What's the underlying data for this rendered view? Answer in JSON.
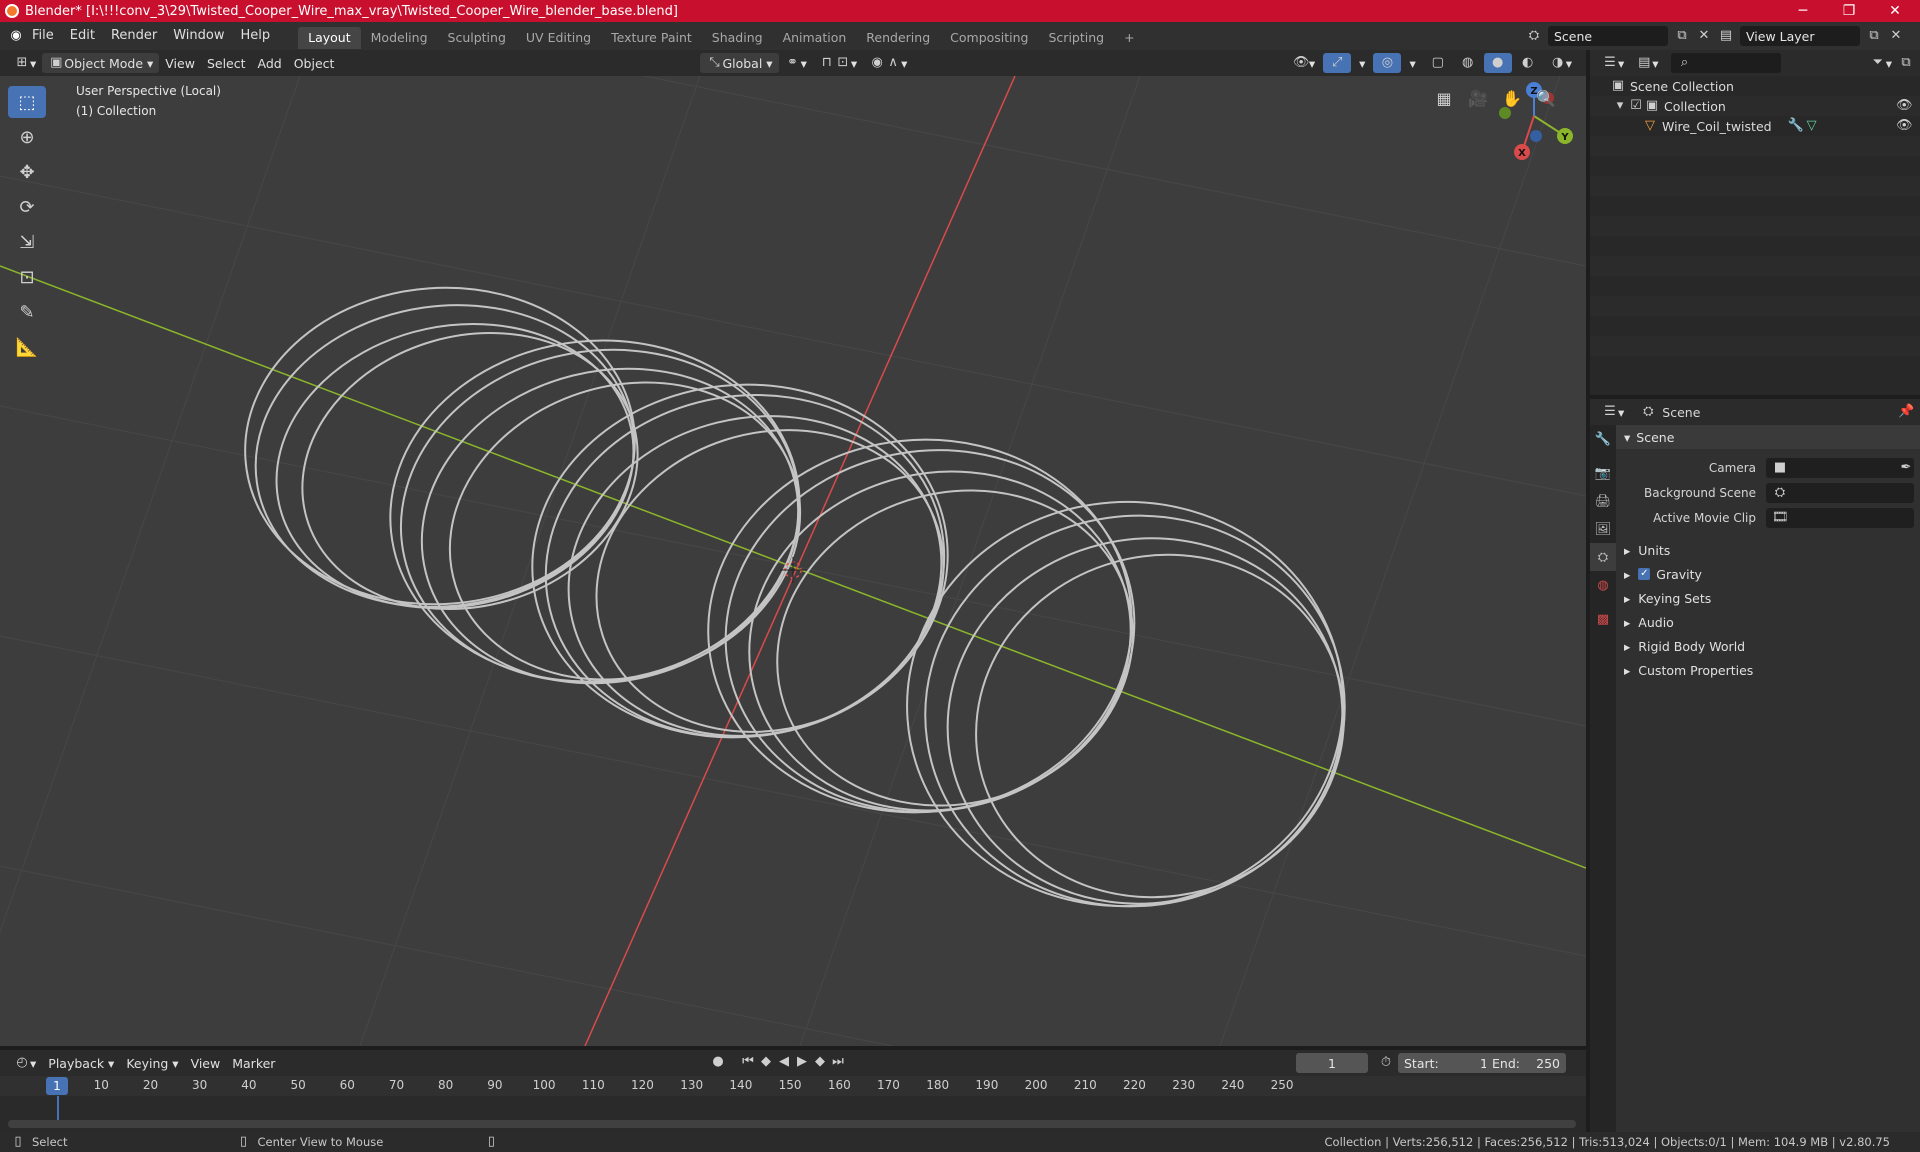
{
  "window": {
    "title": "Blender* [I:\\!!!conv_3\\29\\Twisted_Cooper_Wire_max_vray\\Twisted_Cooper_Wire_blender_base.blend]",
    "minimize": "─",
    "maximize": "❐",
    "close": "✕"
  },
  "menu": [
    "File",
    "Edit",
    "Render",
    "Window",
    "Help"
  ],
  "workspaces": [
    "Layout",
    "Modeling",
    "Sculpting",
    "UV Editing",
    "Texture Paint",
    "Shading",
    "Animation",
    "Rendering",
    "Compositing",
    "Scripting"
  ],
  "add_workspace": "+",
  "scene_field": "Scene",
  "view_layer_field": "View Layer",
  "viewport_header": {
    "mode": "Object Mode",
    "menus": [
      "View",
      "Select",
      "Add",
      "Object"
    ],
    "orientation": "Global"
  },
  "viewport": {
    "perspective": "User Perspective (Local)",
    "collection": "(1) Collection",
    "gizmo": {
      "x": "X",
      "y": "Y",
      "z": "Z"
    }
  },
  "outliner": {
    "root": "Scene Collection",
    "collection": "Collection",
    "object": "Wire_Coil_twisted"
  },
  "properties": {
    "context": "Scene",
    "section": "Scene",
    "fields": [
      {
        "label": "Camera"
      },
      {
        "label": "Background Scene"
      },
      {
        "label": "Active Movie Clip"
      }
    ],
    "panels": [
      "Units",
      "Gravity",
      "Keying Sets",
      "Audio",
      "Rigid Body World",
      "Custom Properties"
    ]
  },
  "timeline": {
    "menus": [
      "Playback",
      "Keying",
      "View",
      "Marker"
    ],
    "current_frame": "1",
    "start_label": "Start:",
    "start": "1",
    "end_label": "End:",
    "end": "250",
    "ruler_current": "1",
    "ticks": [
      "10",
      "20",
      "30",
      "40",
      "50",
      "60",
      "70",
      "80",
      "90",
      "100",
      "110",
      "120",
      "130",
      "140",
      "150",
      "160",
      "170",
      "180",
      "190",
      "200",
      "210",
      "220",
      "230",
      "240",
      "250"
    ]
  },
  "status": {
    "left": "Select",
    "middle": "Center View to Mouse",
    "right": "Collection | Verts:256,512 | Faces:256,512 | Tris:513,024 | Objects:0/1 | Mem: 104.9 MB | v2.80.75"
  },
  "colors": {
    "title_bar": "#c8102e",
    "active_tool": "#4772b3",
    "x_axis": "#d94a4a",
    "y_axis": "#8bb62a",
    "wire": "#c4c4c4"
  }
}
